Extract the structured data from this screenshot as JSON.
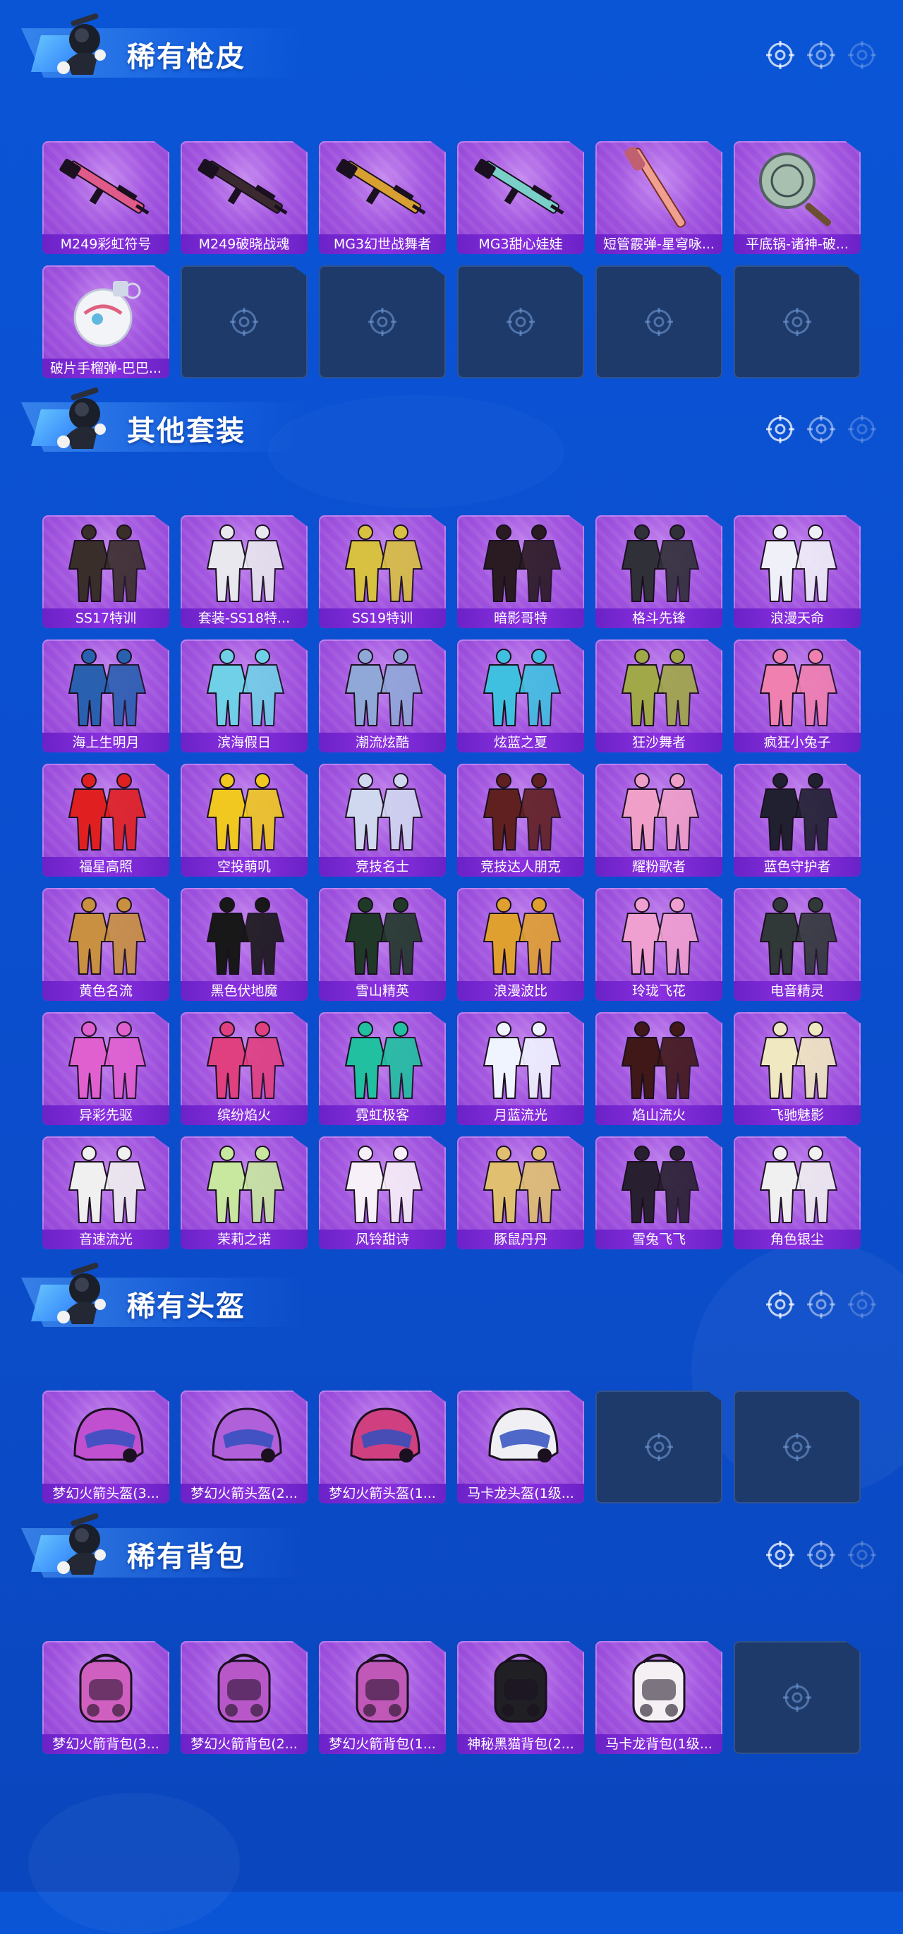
{
  "sections": [
    {
      "title": "稀有枪皮",
      "items": [
        {
          "label": "M249彩虹符号",
          "icon": "machine-gun-icon",
          "color": "#e05a8a"
        },
        {
          "label": "M249破晓战魂",
          "icon": "machine-gun-icon",
          "color": "#3a2a30"
        },
        {
          "label": "MG3幻世战舞者",
          "icon": "machine-gun-icon",
          "color": "#d8a030"
        },
        {
          "label": "MG3甜心娃娃",
          "icon": "machine-gun-icon",
          "color": "#7ad0c8"
        },
        {
          "label": "短管霰弹-星穹咏...",
          "icon": "shotgun-icon",
          "color": "#f0a090"
        },
        {
          "label": "平底锅-诸神-破...",
          "icon": "pan-icon",
          "color": "#a8c0b0"
        },
        {
          "label": "破片手榴弹-巴巴...",
          "icon": "grenade-icon",
          "color": "#f2f4f8"
        },
        {
          "label": "",
          "icon": "crosshair-icon",
          "empty": true
        },
        {
          "label": "",
          "icon": "crosshair-icon",
          "empty": true
        },
        {
          "label": "",
          "icon": "crosshair-icon",
          "empty": true
        },
        {
          "label": "",
          "icon": "crosshair-icon",
          "empty": true
        },
        {
          "label": "",
          "icon": "crosshair-icon",
          "empty": true
        }
      ]
    },
    {
      "title": "其他套装",
      "items": [
        {
          "label": "SS17特训",
          "icon": "outfit-icon",
          "color": "#3a2e2a"
        },
        {
          "label": "套装-SS18特...",
          "icon": "outfit-icon",
          "color": "#e8e8ee"
        },
        {
          "label": "SS19特训",
          "icon": "outfit-icon",
          "color": "#d8c040"
        },
        {
          "label": "暗影哥特",
          "icon": "outfit-icon",
          "color": "#2a1a22"
        },
        {
          "label": "格斗先锋",
          "icon": "outfit-icon",
          "color": "#303038"
        },
        {
          "label": "浪漫天命",
          "icon": "outfit-icon",
          "color": "#f0f0f8"
        },
        {
          "label": "海上生明月",
          "icon": "outfit-icon",
          "color": "#2a60b0"
        },
        {
          "label": "滨海假日",
          "icon": "outfit-icon",
          "color": "#70d0e8"
        },
        {
          "label": "潮流炫酷",
          "icon": "outfit-icon",
          "color": "#90a8d8"
        },
        {
          "label": "炫蓝之夏",
          "icon": "outfit-icon",
          "color": "#40c0e0"
        },
        {
          "label": "狂沙舞者",
          "icon": "outfit-icon",
          "color": "#a0a848"
        },
        {
          "label": "疯狂小兔子",
          "icon": "outfit-icon",
          "color": "#f080b0"
        },
        {
          "label": "福星高照",
          "icon": "outfit-icon",
          "color": "#e02020"
        },
        {
          "label": "空投萌叽",
          "icon": "outfit-icon",
          "color": "#f0c820"
        },
        {
          "label": "竞技名士",
          "icon": "outfit-icon",
          "color": "#d0d8f0"
        },
        {
          "label": "竞技达人朋克",
          "icon": "outfit-icon",
          "color": "#602020"
        },
        {
          "label": "耀粉歌者",
          "icon": "outfit-icon",
          "color": "#f0a0c8"
        },
        {
          "label": "蓝色守护者",
          "icon": "outfit-icon",
          "color": "#202030"
        },
        {
          "label": "黄色名流",
          "icon": "outfit-icon",
          "color": "#c89040"
        },
        {
          "label": "黑色伏地魔",
          "icon": "outfit-icon",
          "color": "#181818"
        },
        {
          "label": "雪山精英",
          "icon": "outfit-icon",
          "color": "#203828"
        },
        {
          "label": "浪漫波比",
          "icon": "outfit-icon",
          "color": "#e0a030"
        },
        {
          "label": "玲珑飞花",
          "icon": "outfit-icon",
          "color": "#f0a0d0"
        },
        {
          "label": "电音精灵",
          "icon": "outfit-icon",
          "color": "#303838"
        },
        {
          "label": "异彩先驱",
          "icon": "outfit-icon",
          "color": "#e060d0"
        },
        {
          "label": "缤纷焰火",
          "icon": "outfit-icon",
          "color": "#e04080"
        },
        {
          "label": "霓虹极客",
          "icon": "outfit-icon",
          "color": "#20c0a0"
        },
        {
          "label": "月蓝流光",
          "icon": "outfit-icon",
          "color": "#f0f4ff"
        },
        {
          "label": "焰山流火",
          "icon": "outfit-icon",
          "color": "#401818"
        },
        {
          "label": "飞驰魅影",
          "icon": "outfit-icon",
          "color": "#f0e8c0"
        },
        {
          "label": "音速流光",
          "icon": "outfit-icon",
          "color": "#f0f0f0"
        },
        {
          "label": "茉莉之诺",
          "icon": "outfit-icon",
          "color": "#c8e8a0"
        },
        {
          "label": "风铃甜诗",
          "icon": "outfit-icon",
          "color": "#f8f0f8"
        },
        {
          "label": "豚鼠丹丹",
          "icon": "outfit-icon",
          "color": "#e0c070"
        },
        {
          "label": "雪兔飞飞",
          "icon": "outfit-icon",
          "color": "#282030"
        },
        {
          "label": "角色银尘",
          "icon": "outfit-icon",
          "color": "#f0f0f0"
        }
      ]
    },
    {
      "title": "稀有头盔",
      "items": [
        {
          "label": "梦幻火箭头盔(3...",
          "icon": "helmet-icon",
          "color": "#c050d0"
        },
        {
          "label": "梦幻火箭头盔(2...",
          "icon": "helmet-icon",
          "color": "#b060d8"
        },
        {
          "label": "梦幻火箭头盔(1...",
          "icon": "helmet-icon",
          "color": "#d04080"
        },
        {
          "label": "马卡龙头盔(1级...",
          "icon": "helmet-icon",
          "color": "#f0f0f4"
        },
        {
          "label": "",
          "icon": "crosshair-icon",
          "empty": true
        },
        {
          "label": "",
          "icon": "crosshair-icon",
          "empty": true
        }
      ]
    },
    {
      "title": "稀有背包",
      "items": [
        {
          "label": "梦幻火箭背包(3...",
          "icon": "backpack-icon",
          "color": "#d060c0"
        },
        {
          "label": "梦幻火箭背包(2...",
          "icon": "backpack-icon",
          "color": "#b858c8"
        },
        {
          "label": "梦幻火箭背包(1...",
          "icon": "backpack-icon",
          "color": "#c058b8"
        },
        {
          "label": "神秘黑猫背包(2...",
          "icon": "backpack-icon",
          "color": "#202024"
        },
        {
          "label": "马卡龙背包(1级...",
          "icon": "backpack-icon",
          "color": "#f4f0f4"
        },
        {
          "label": "",
          "icon": "crosshair-icon",
          "empty": true
        }
      ]
    }
  ]
}
